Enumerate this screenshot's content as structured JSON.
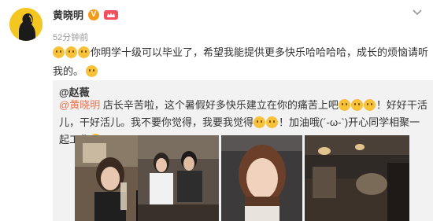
{
  "post": {
    "author": "黄晓明",
    "verified_badge": "V",
    "time": "52分钟前",
    "text": "你明学十级可以毕业了，希望我能提供更多快乐哈哈哈哈，成长的烦恼请听我的。",
    "colors": {
      "accent": "#eb7350",
      "vip": "#f49b1a",
      "crown": "#f24e5b",
      "repost_bg": "#f2f2f2"
    }
  },
  "repost": {
    "author": "@赵薇",
    "mention": "@黄晓明",
    "text_part1": " 店长辛苦啦，这个暑假好多快乐建立在你的痛苦上吧",
    "text_part2": "！好好干活儿，干好活儿。我不要你觉得，我要我觉得",
    "text_part3": "！加油哦(´-ω-`)开心同学相聚一起工作"
  },
  "photos": [
    {
      "name": "photo-1"
    },
    {
      "name": "photo-2"
    },
    {
      "name": "photo-3"
    },
    {
      "name": "photo-4"
    }
  ]
}
